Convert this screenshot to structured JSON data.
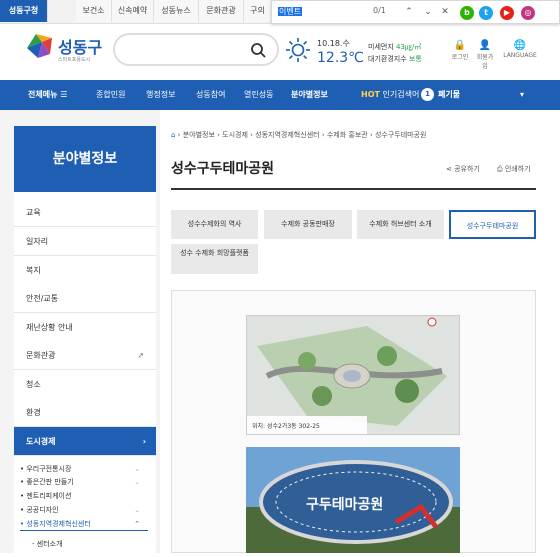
{
  "topbar": {
    "tabs": [
      "성동구청",
      "보건소",
      "신속예약",
      "성동뉴스",
      "문화관광",
      "구의"
    ]
  },
  "find": {
    "query": "이벤트",
    "count": "0/1"
  },
  "brand": {
    "name": "성동구",
    "tagline": "스마트포용도시"
  },
  "weather": {
    "date": "10.18.수",
    "temp": "12.3℃",
    "dust_label": "미세먼지",
    "dust_value": "43㎍/㎥",
    "air_label": "대기환경지수",
    "air_value": "보통"
  },
  "header_links": [
    "로그인",
    "회원가입",
    "LANGUAGE"
  ],
  "nav": {
    "all": "전체메뉴",
    "items": [
      "종합민원",
      "행정정보",
      "성동참여",
      "열린성동",
      "분야별정보"
    ],
    "hot_label": "HOT",
    "hot_text": "인기검색어",
    "rank": "1",
    "keyword": "폐기물"
  },
  "sidebar": {
    "title": "분야별정보",
    "items": [
      "교육",
      "일자리",
      "복지",
      "안전/교통",
      "재난상황 안내",
      "문화관광",
      "청소",
      "환경",
      "도시경제"
    ],
    "subs": [
      "우리구전통시장",
      "좋은간판 만들기",
      "젠트리피케이션",
      "공공디자인",
      "성동지역경제혁신센터",
      "센터소개"
    ]
  },
  "breadcrumb": [
    "분야별정보",
    "도시경제",
    "성동지역경제혁신센터",
    "수제화 홍보관",
    "성수구두테마공원"
  ],
  "page": {
    "title": "성수구두테마공원",
    "share": "공유하기",
    "print": "인쇄하기"
  },
  "tabs": [
    "성수수제화의 역사",
    "수제화 공동판매장",
    "수제화 허브센터 소개",
    "성수구두테마공원",
    "성수 수제화 희망플랫폼"
  ],
  "content": {
    "caption": "위치: 성수2가3동 302-25",
    "sign": "구두테마공원"
  }
}
